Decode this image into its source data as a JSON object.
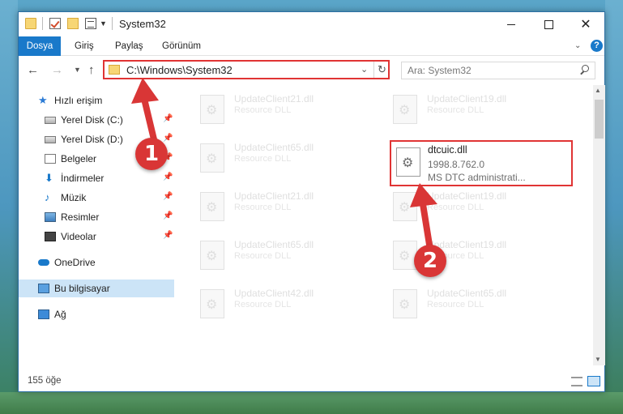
{
  "titlebar": {
    "title": "System32"
  },
  "ribbon": {
    "tabs": [
      "Dosya",
      "Giriş",
      "Paylaş",
      "Görünüm"
    ]
  },
  "address": {
    "path": "C:\\Windows\\System32"
  },
  "search": {
    "placeholder": "Ara: System32"
  },
  "sidebar": {
    "items": [
      {
        "label": "Hızlı erişim",
        "icon": "star-icon"
      },
      {
        "label": "Yerel Disk (C:)",
        "icon": "disk-icon"
      },
      {
        "label": "Yerel Disk (D:)",
        "icon": "disk-icon"
      },
      {
        "label": "Belgeler",
        "icon": "document-icon"
      },
      {
        "label": "İndirmeler",
        "icon": "download-icon"
      },
      {
        "label": "Müzik",
        "icon": "music-icon"
      },
      {
        "label": "Resimler",
        "icon": "pictures-icon"
      },
      {
        "label": "Videolar",
        "icon": "video-icon"
      },
      {
        "label": "OneDrive",
        "icon": "cloud-icon"
      },
      {
        "label": "Bu bilgisayar",
        "icon": "computer-icon"
      },
      {
        "label": "Ağ",
        "icon": "network-icon"
      }
    ]
  },
  "files": [
    {
      "name": "UpdateClient21.dll",
      "type": "Resource DLL"
    },
    {
      "name": "UpdateClient19.dll",
      "type": "Resource DLL"
    },
    {
      "name": "UpdateClient65.dll",
      "type": "Resource DLL"
    },
    {
      "name": "UpdateClient21.dll",
      "type": "Resource DLL"
    },
    {
      "name": "UpdateClient19.dll",
      "type": "Resource DLL"
    },
    {
      "name": "UpdateClient65.dll",
      "type": "Resource DLL"
    },
    {
      "name": "UpdateClient19.dll",
      "type": "Resource DLL"
    },
    {
      "name": "UpdateClient42.dll",
      "type": "Resource DLL"
    },
    {
      "name": "UpdateClient65.dll",
      "type": "Resource DLL"
    }
  ],
  "highlighted_file": {
    "name": "dtcuic.dll",
    "version": "1998.8.762.0",
    "description": "MS DTC administrati..."
  },
  "status": {
    "count": "155 öğe"
  },
  "annotations": {
    "step1": "1",
    "step2": "2",
    "color": "#d93636"
  }
}
